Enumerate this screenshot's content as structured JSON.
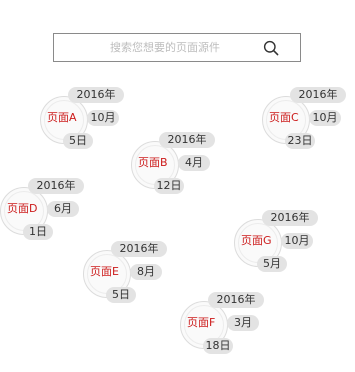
{
  "search": {
    "placeholder": "搜索您想要的页面源件"
  },
  "colors": {
    "accent": "#cc1b1b",
    "pill_bg": "#e3e3e3",
    "text": "#333333"
  },
  "icons": {
    "search": "search-icon"
  },
  "entries": [
    {
      "id": "A",
      "label": "页面A",
      "year": "2016年",
      "month": "10月",
      "day": "5日"
    },
    {
      "id": "B",
      "label": "页面B",
      "year": "2016年",
      "month": "4月",
      "day": "12日"
    },
    {
      "id": "C",
      "label": "页面C",
      "year": "2016年",
      "month": "10月",
      "day": "23日"
    },
    {
      "id": "D",
      "label": "页面D",
      "year": "2016年",
      "month": "6月",
      "day": "1日"
    },
    {
      "id": "E",
      "label": "页面E",
      "year": "2016年",
      "month": "8月",
      "day": "5日"
    },
    {
      "id": "F",
      "label": "页面F",
      "year": "2016年",
      "month": "3月",
      "day": "18日"
    },
    {
      "id": "G",
      "label": "页面G",
      "year": "2016年",
      "month": "10月",
      "day": "5月"
    }
  ]
}
